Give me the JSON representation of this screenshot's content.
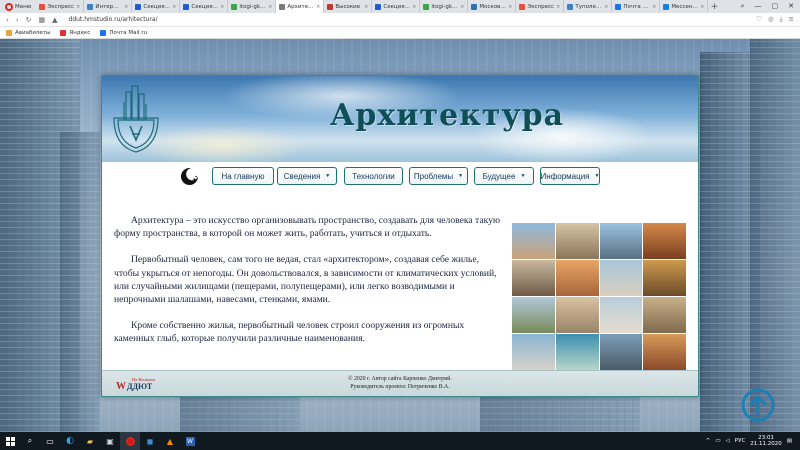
{
  "browser": {
    "menu_label": "Меню",
    "tabs": [
      {
        "label": "Экспресс"
      },
      {
        "label": "Интернет"
      },
      {
        "label": "Секция \"Б"
      },
      {
        "label": "Секция \"Б"
      },
      {
        "label": "itogi-gk-m"
      },
      {
        "label": "Архитекту",
        "active": true
      },
      {
        "label": "Высокие"
      },
      {
        "label": "Секция \"Б"
      },
      {
        "label": "itogi-gk-m"
      },
      {
        "label": "Московск"
      },
      {
        "label": "Экспресс"
      },
      {
        "label": "Туполевск"
      },
      {
        "label": "Почта Mail"
      },
      {
        "label": "Мессендж"
      }
    ],
    "new_tab": "+",
    "url": "ddut.hmstudio.ru/arhitectura/",
    "bookmarks": [
      {
        "label": "Авиабилеты",
        "color": "#e8a33a"
      },
      {
        "label": "Яндекс",
        "color": "#e62e2e"
      },
      {
        "label": "Почта Mail.ru",
        "color": "#1a73e8"
      }
    ]
  },
  "site": {
    "title": "Архитектура",
    "nav": [
      {
        "label": "На главную",
        "dropdown": false
      },
      {
        "label": "Сведения",
        "dropdown": true
      },
      {
        "label": "Технологии",
        "dropdown": false
      },
      {
        "label": "Проблемы",
        "dropdown": true
      },
      {
        "label": "Будущее",
        "dropdown": true
      },
      {
        "label": "Информация",
        "dropdown": true
      }
    ],
    "paragraphs": [
      "Архитектура – это искусство организовывать пространство, создавать для человека такую форму пространства, в которой он может жить, работать, учиться и отдыхать.",
      "Первобытный человек, сам того не ведая, стал «архитектором», создавая себе жилье, чтобы укрыться от непогоды. Он довольствовался, в зависимости от климатических условий, или случайными жилищами (пещерами, полупещерами), или легко возводимыми и непрочными шалашами, навесами, стенками, ямами.",
      "Кроме собственно жилья, первобытный человек строил сооружения из огромных каменных глыб, которые получили различные наименования."
    ],
    "footer": {
      "logo_top": "На Вешкаха",
      "logo_bottom": "ДДЮТ",
      "line1": "© 2020 г. Автор сайта Карпенко Дмитрий.",
      "line2": "Руководитель проекта: Петриченко В.А."
    }
  },
  "taskbar": {
    "lang": "РУС",
    "time": "23:01",
    "date": "21.11.2020"
  },
  "colors": {
    "accent_teal": "#1f6f6f",
    "title_color": "#0e4e57",
    "nav_text": "#1a3b60"
  }
}
